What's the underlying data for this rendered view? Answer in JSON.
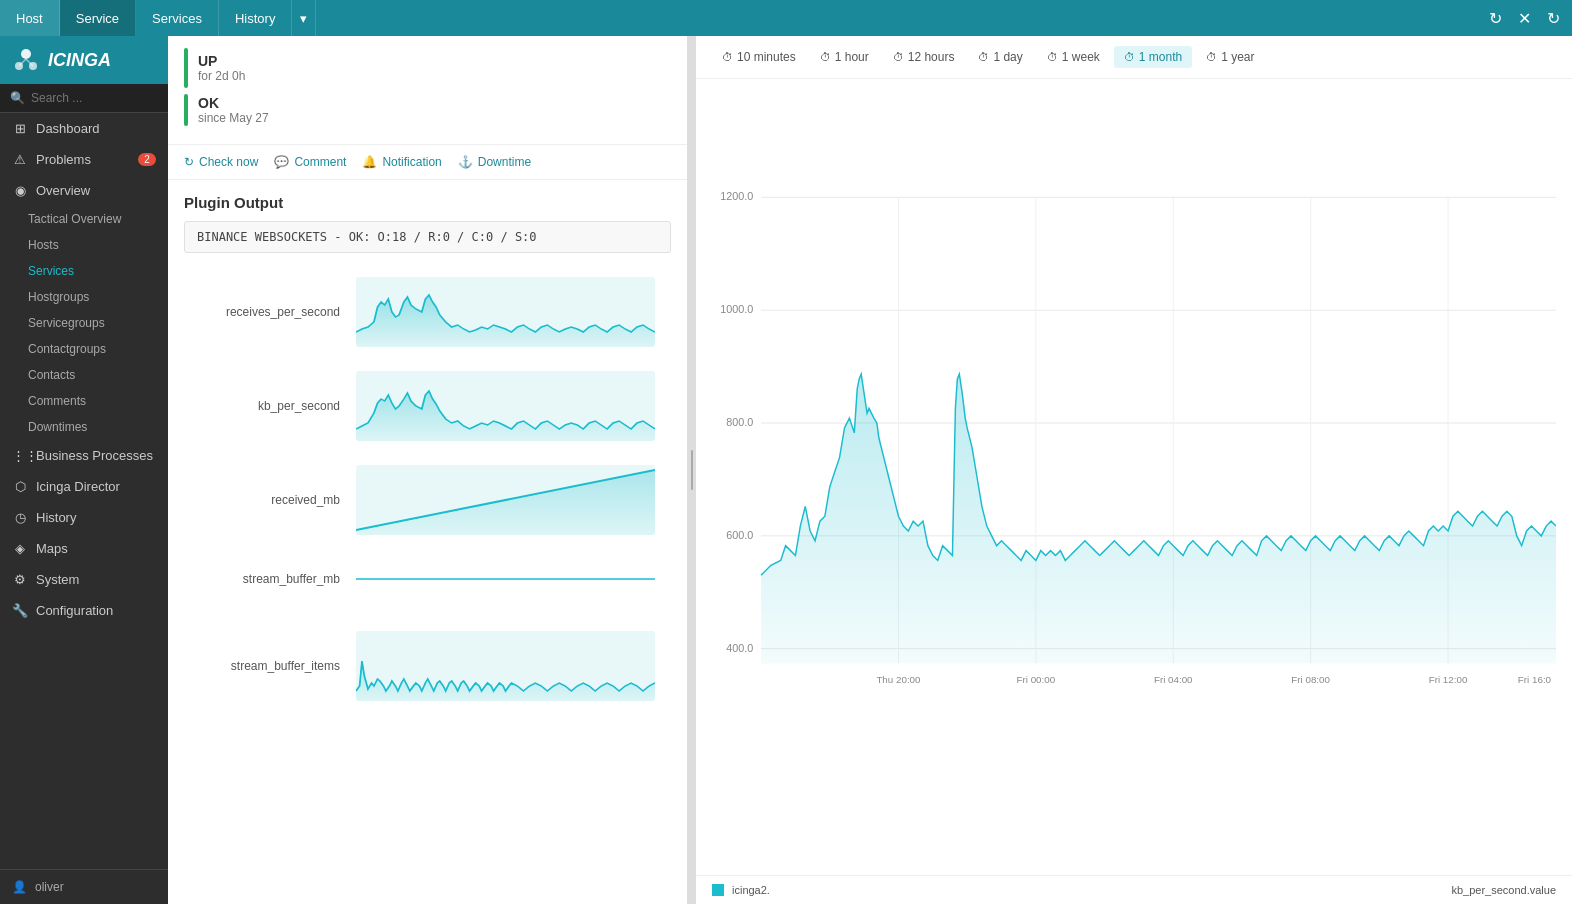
{
  "app": {
    "name": "icinga",
    "logo_text": "ICINGA"
  },
  "top_nav": {
    "tabs": [
      {
        "id": "host",
        "label": "Host",
        "active": false
      },
      {
        "id": "service",
        "label": "Service",
        "active": true
      },
      {
        "id": "services",
        "label": "Services",
        "active": false
      },
      {
        "id": "history",
        "label": "History",
        "active": false
      }
    ],
    "close_label": "✕",
    "refresh_label": "↻",
    "dropdown_label": "▾"
  },
  "sidebar": {
    "search_placeholder": "Search ...",
    "items": [
      {
        "id": "dashboard",
        "label": "Dashboard",
        "icon": "⊞"
      },
      {
        "id": "problems",
        "label": "Problems",
        "icon": "⚠",
        "badge": "2"
      },
      {
        "id": "overview",
        "label": "Overview",
        "icon": "◉"
      },
      {
        "id": "tactical-overview",
        "label": "Tactical Overview",
        "sub": true
      },
      {
        "id": "hosts",
        "label": "Hosts",
        "sub": true
      },
      {
        "id": "services",
        "label": "Services",
        "sub": true,
        "active": true
      },
      {
        "id": "hostgroups",
        "label": "Hostgroups",
        "sub": true
      },
      {
        "id": "servicegroups",
        "label": "Servicegroups",
        "sub": true
      },
      {
        "id": "contactgroups",
        "label": "Contactgroups",
        "sub": true
      },
      {
        "id": "contacts",
        "label": "Contacts",
        "sub": true
      },
      {
        "id": "comments",
        "label": "Comments",
        "sub": true
      },
      {
        "id": "downtimes",
        "label": "Downtimes",
        "sub": true
      },
      {
        "id": "business-processes",
        "label": "Business Processes",
        "icon": "⋮⋮"
      },
      {
        "id": "icinga-director",
        "label": "Icinga Director",
        "icon": "⬡"
      },
      {
        "id": "history",
        "label": "History",
        "icon": "◷"
      },
      {
        "id": "maps",
        "label": "Maps",
        "icon": "◈"
      },
      {
        "id": "system",
        "label": "System",
        "icon": "⚙"
      },
      {
        "id": "configuration",
        "label": "Configuration",
        "icon": "🔧"
      }
    ],
    "user": "oliver",
    "user_icon": "👤"
  },
  "detail": {
    "status_up": "UP",
    "status_up_sub": "for 2d 0h",
    "status_ok": "OK",
    "status_ok_sub": "since May 27",
    "actions": [
      {
        "id": "check-now",
        "label": "Check now",
        "icon": "↻"
      },
      {
        "id": "comment",
        "label": "Comment",
        "icon": "💬"
      },
      {
        "id": "notification",
        "label": "Notification",
        "icon": "🔔"
      },
      {
        "id": "downtime",
        "label": "Downtime",
        "icon": "⚓"
      }
    ],
    "plugin_output_title": "Plugin Output",
    "plugin_output": "BINANCE WEBSOCKETS - OK: O:18 / R:0 / C:0 / S:0",
    "metrics": [
      {
        "id": "receives_per_second",
        "label": "receives_per_second",
        "type": "spiky"
      },
      {
        "id": "kb_per_second",
        "label": "kb_per_second",
        "type": "spiky2"
      },
      {
        "id": "received_mb",
        "label": "received_mb",
        "type": "linear"
      },
      {
        "id": "stream_buffer_mb",
        "label": "stream_buffer_mb",
        "type": "flat"
      },
      {
        "id": "stream_buffer_items",
        "label": "stream_buffer_items",
        "type": "spiky3"
      }
    ]
  },
  "chart": {
    "time_buttons": [
      {
        "id": "10min",
        "label": "10 minutes",
        "active": false
      },
      {
        "id": "1hour",
        "label": "1 hour",
        "active": false
      },
      {
        "id": "12hours",
        "label": "12 hours",
        "active": false
      },
      {
        "id": "1day",
        "label": "1 day",
        "active": false
      },
      {
        "id": "1week",
        "label": "1 week",
        "active": false
      },
      {
        "id": "1month",
        "label": "1 month",
        "active": true
      },
      {
        "id": "1year",
        "label": "1 year",
        "active": false
      }
    ],
    "y_labels": [
      "1200.0",
      "1000.0",
      "800.0",
      "600.0",
      "400.0"
    ],
    "x_labels": [
      "Thu 20:00",
      "Fri 00:00",
      "Fri 04:00",
      "Fri 08:00",
      "Fri 12:00",
      "Fri 16:0"
    ],
    "legend_label": "icinga2.",
    "value_label": "kb_per_second.value",
    "color": "#1abcce"
  }
}
